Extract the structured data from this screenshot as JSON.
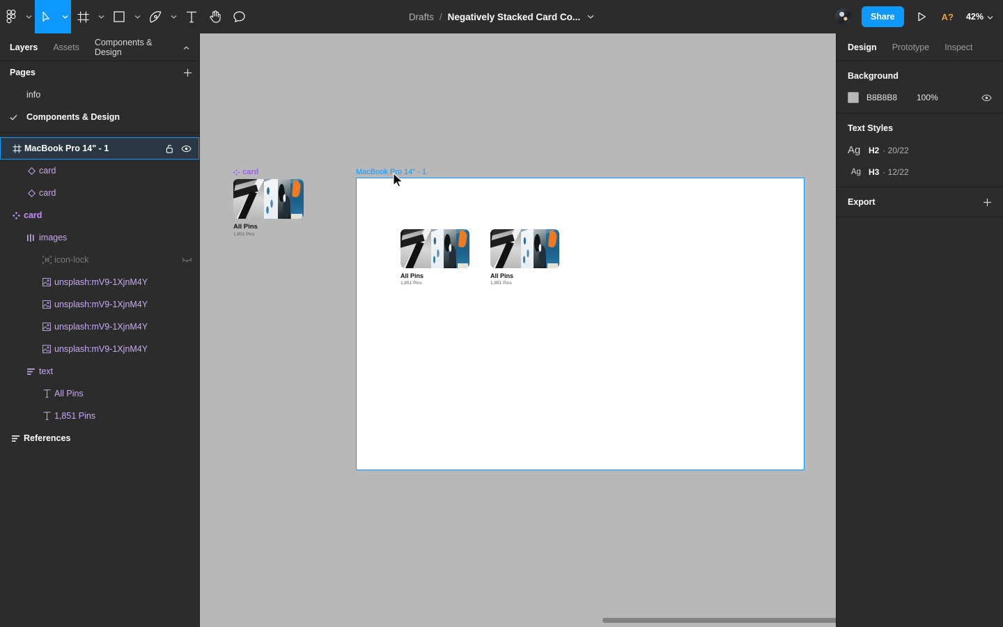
{
  "toolbar": {
    "tools": [
      {
        "name": "figma-menu-icon",
        "caret": true
      },
      {
        "name": "move-tool-icon",
        "caret": true,
        "active": true
      },
      {
        "name": "frame-tool-icon",
        "caret": true
      },
      {
        "name": "shape-tool-icon",
        "caret": true
      },
      {
        "name": "pen-tool-icon",
        "caret": true
      },
      {
        "name": "text-tool-icon",
        "caret": false
      },
      {
        "name": "hand-tool-icon",
        "caret": false
      },
      {
        "name": "comment-tool-icon",
        "caret": false
      }
    ]
  },
  "title": {
    "breadcrumb_root": "Drafts",
    "separator": "/",
    "file_name": "Negatively Stacked Card Co..."
  },
  "topbar_right": {
    "share_label": "Share",
    "alerts_label": "A?",
    "zoom_level": "42%"
  },
  "left_panel": {
    "tabs": [
      {
        "label": "Layers",
        "active": true
      },
      {
        "label": "Assets",
        "active": false
      }
    ],
    "library_label": "Components & Design",
    "pages_title": "Pages",
    "pages": [
      {
        "label": "info",
        "selected": false
      },
      {
        "label": "Components & Design",
        "selected": true
      }
    ],
    "layers": [
      {
        "label": "MacBook Pro 14\" - 1",
        "icon": "frame-icon",
        "type": "frame",
        "indent": 0,
        "selected": true,
        "lock": true,
        "eye": true
      },
      {
        "label": "card",
        "icon": "instance-icon",
        "type": "instance",
        "indent": 1,
        "selected": false
      },
      {
        "label": "card",
        "icon": "instance-icon",
        "type": "instance",
        "indent": 1,
        "selected": false
      },
      {
        "label": "card",
        "icon": "component-icon",
        "type": "component",
        "indent": 0,
        "selected": false
      },
      {
        "label": "images",
        "icon": "auto-layout-horizontal-icon",
        "type": "group",
        "indent": 1,
        "selected": false
      },
      {
        "label": "icon-lock",
        "icon": "section-icon",
        "type": "hidden",
        "indent": 2,
        "selected": false,
        "hidden_eye": true
      },
      {
        "label": "unsplash:mV9-1XjnM4Y",
        "icon": "image-icon",
        "type": "image",
        "indent": 2,
        "selected": false
      },
      {
        "label": "unsplash:mV9-1XjnM4Y",
        "icon": "image-icon",
        "type": "image",
        "indent": 2,
        "selected": false
      },
      {
        "label": "unsplash:mV9-1XjnM4Y",
        "icon": "image-icon",
        "type": "image",
        "indent": 2,
        "selected": false
      },
      {
        "label": "unsplash:mV9-1XjnM4Y",
        "icon": "image-icon",
        "type": "image",
        "indent": 2,
        "selected": false
      },
      {
        "label": "text",
        "icon": "auto-layout-vertical-icon",
        "type": "group",
        "indent": 1,
        "selected": false
      },
      {
        "label": "All Pins",
        "icon": "text-layer-icon",
        "type": "text",
        "indent": 2,
        "selected": false
      },
      {
        "label": "1,851 Pins",
        "icon": "text-layer-icon",
        "type": "text",
        "indent": 2,
        "selected": false
      },
      {
        "label": "References",
        "icon": "auto-layout-vertical-icon",
        "type": "frame",
        "indent": 0,
        "selected": false
      }
    ]
  },
  "canvas": {
    "background_color": "#B8B8B8",
    "component_label": "card",
    "frame_label": "MacBook Pro 14\" - 1",
    "cards": [
      {
        "title": "All Pins",
        "subtitle": "1,851 Pins"
      },
      {
        "title": "All Pins",
        "subtitle": "1,851 Pins"
      },
      {
        "title": "All Pins",
        "subtitle": "1,851 Pins"
      }
    ]
  },
  "right_panel": {
    "tabs": [
      {
        "label": "Design",
        "active": true
      },
      {
        "label": "Prototype",
        "active": false
      },
      {
        "label": "Inspect",
        "active": false
      }
    ],
    "background": {
      "title": "Background",
      "hex": "B8B8B8",
      "opacity": "100%",
      "color": "#B8B8B8"
    },
    "text_styles": {
      "title": "Text Styles",
      "items": [
        {
          "preview": "Ag",
          "name": "H2",
          "meta": "· 20/22",
          "size": "big"
        },
        {
          "preview": "Ag",
          "name": "H3",
          "meta": "· 12/22",
          "size": "small"
        }
      ]
    },
    "export": {
      "title": "Export"
    }
  },
  "help": {
    "label": "?"
  },
  "accent_color": "#0D99FF",
  "purple_color": "#A259FF"
}
